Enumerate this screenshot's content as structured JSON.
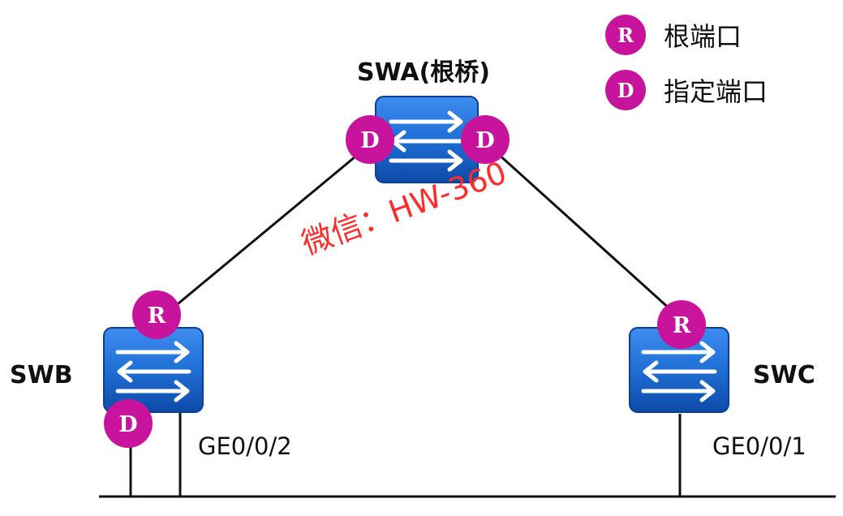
{
  "title": "SWA(根桥)",
  "legend": [
    {
      "badge": "R",
      "text": "根端口"
    },
    {
      "badge": "D",
      "text": "指定端口"
    }
  ],
  "switches": {
    "swa": {
      "name": "SWA(根桥)"
    },
    "swb": {
      "name": "SWB"
    },
    "swc": {
      "name": "SWC"
    }
  },
  "ports": {
    "swa_left": "D",
    "swa_right": "D",
    "swb_up": "R",
    "swb_down": "D",
    "swc_up": "R"
  },
  "interfaces": {
    "swb": "GE0/0/2",
    "swc": "GE0/0/1"
  },
  "watermark": "微信：HW-360",
  "colors": {
    "badge": "#c8139c",
    "switch_fill": "#1f6fd6",
    "switch_dark": "#0d4aa8",
    "line": "#111111",
    "watermark": "#ff2a2a"
  }
}
